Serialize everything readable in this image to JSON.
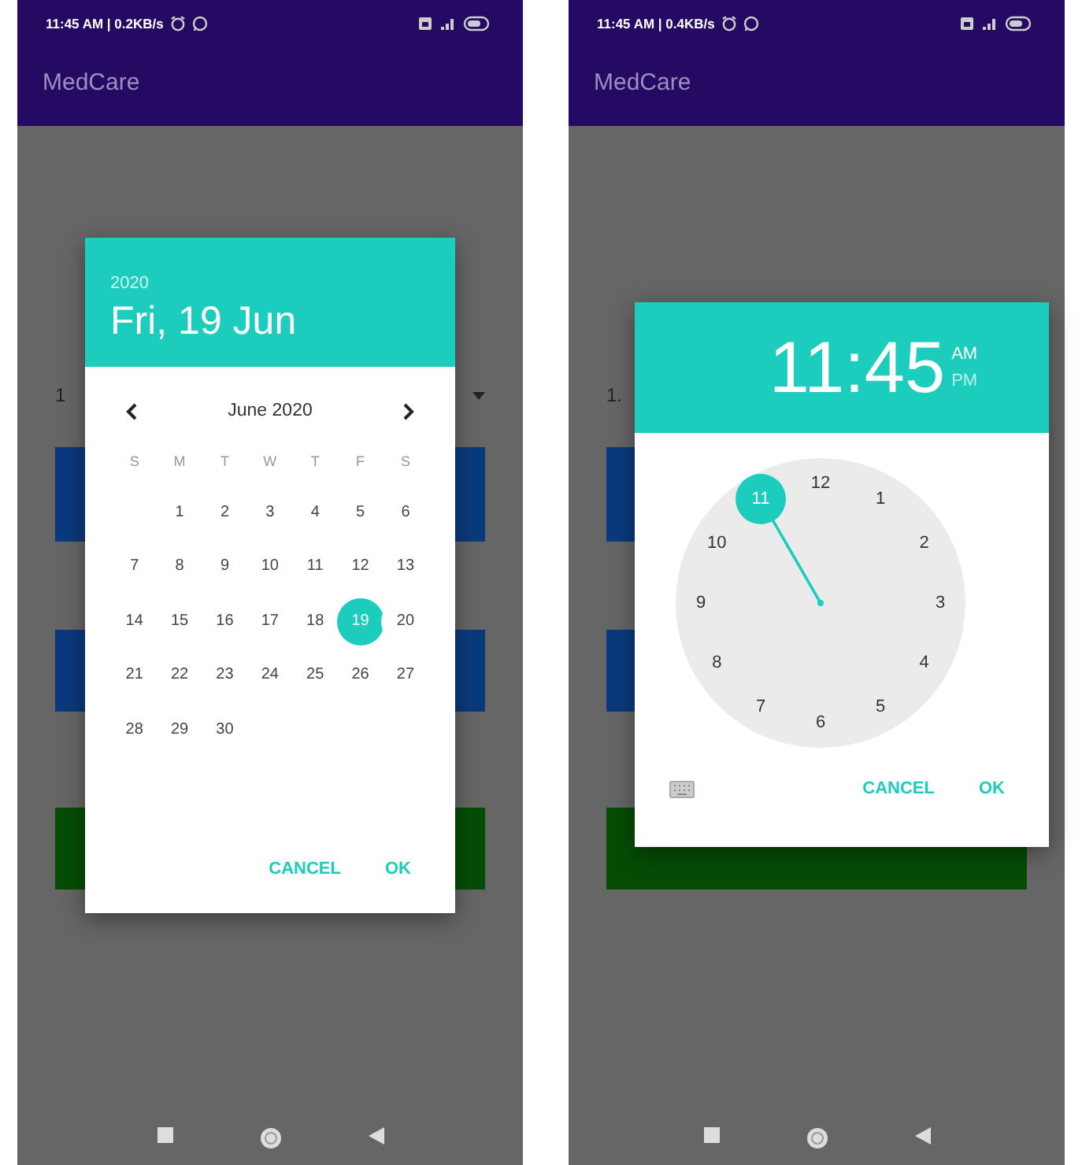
{
  "phones": [
    {
      "status_bar": {
        "time": "11:45 AM | 0.2KB/s"
      },
      "app_title": "MedCare",
      "background_text": "1",
      "dialog": {
        "kind": "date",
        "year": "2020",
        "date": "Fri, 19 Jun",
        "month": "June 2020",
        "weekdays": [
          "S",
          "M",
          "T",
          "W",
          "T",
          "F",
          "S"
        ],
        "days": [
          {
            "label": "1",
            "selected": false
          },
          {
            "label": "2",
            "selected": false
          },
          {
            "label": "3",
            "selected": false
          },
          {
            "label": "4",
            "selected": false
          },
          {
            "label": "5",
            "selected": false
          },
          {
            "label": "6",
            "selected": false
          },
          {
            "label": "7",
            "selected": false
          },
          {
            "label": "8",
            "selected": false
          },
          {
            "label": "9",
            "selected": false
          },
          {
            "label": "10",
            "selected": false
          },
          {
            "label": "11",
            "selected": false
          },
          {
            "label": "12",
            "selected": false
          },
          {
            "label": "13",
            "selected": false
          },
          {
            "label": "14",
            "selected": false
          },
          {
            "label": "15",
            "selected": false
          },
          {
            "label": "16",
            "selected": false
          },
          {
            "label": "17",
            "selected": false
          },
          {
            "label": "18",
            "selected": false
          },
          {
            "label": "19",
            "selected": true
          },
          {
            "label": "20",
            "selected": false
          },
          {
            "label": "21",
            "selected": false
          },
          {
            "label": "22",
            "selected": false
          },
          {
            "label": "23",
            "selected": false
          },
          {
            "label": "24",
            "selected": false
          },
          {
            "label": "25",
            "selected": false
          },
          {
            "label": "26",
            "selected": false
          },
          {
            "label": "27",
            "selected": false
          },
          {
            "label": "28",
            "selected": false
          },
          {
            "label": "29",
            "selected": false
          },
          {
            "label": "30",
            "selected": false
          }
        ],
        "buttons": [
          "CANCEL",
          "OK"
        ]
      }
    },
    {
      "status_bar": {
        "time": "11:45 AM | 0.4KB/s"
      },
      "app_title": "MedCare",
      "background_text": "1.",
      "dialog": {
        "kind": "time",
        "time": "11:45",
        "periods": [
          {
            "label": "AM",
            "selected": true
          },
          {
            "label": "PM",
            "selected": false
          }
        ],
        "numbers": [
          {
            "label": "12",
            "selected": false
          },
          {
            "label": "1",
            "selected": false
          },
          {
            "label": "2",
            "selected": false
          },
          {
            "label": "3",
            "selected": false
          },
          {
            "label": "4",
            "selected": false
          },
          {
            "label": "5",
            "selected": false
          },
          {
            "label": "6",
            "selected": false
          },
          {
            "label": "7",
            "selected": false
          },
          {
            "label": "8",
            "selected": false
          },
          {
            "label": "9",
            "selected": false
          },
          {
            "label": "10",
            "selected": false
          },
          {
            "label": "11",
            "selected": true
          }
        ],
        "buttons": [
          "CANCEL",
          "OK"
        ]
      }
    }
  ]
}
